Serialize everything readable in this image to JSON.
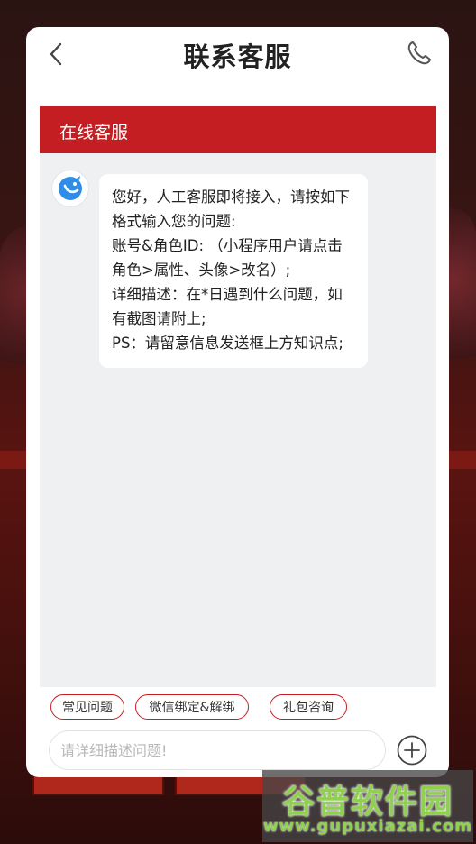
{
  "header": {
    "title": "联系客服",
    "back_icon": "chevron-left-icon",
    "phone_icon": "phone-icon"
  },
  "service_bar": {
    "label": "在线客服",
    "color": "#c41e22"
  },
  "chat": {
    "avatar_icon": "service-bot-icon",
    "message_lines": [
      "您好，人工客服即将接入，请按如下格式输入您的问题:",
      "账号&角色ID: （小程序用户请点击角色>属性、头像>改名）;",
      "详细描述：在*日遇到什么问题，如有截图请附上;",
      "PS：请留意信息发送框上方知识点;"
    ]
  },
  "quick_replies": [
    "常见问题",
    "微信绑定&解绑",
    "礼包咨询"
  ],
  "input": {
    "placeholder": "请详细描述问题!",
    "value": "",
    "send_icon": "plus-circle-icon"
  },
  "watermark": {
    "title": "谷普软件园",
    "url": "www.gupuxiazai.com"
  }
}
